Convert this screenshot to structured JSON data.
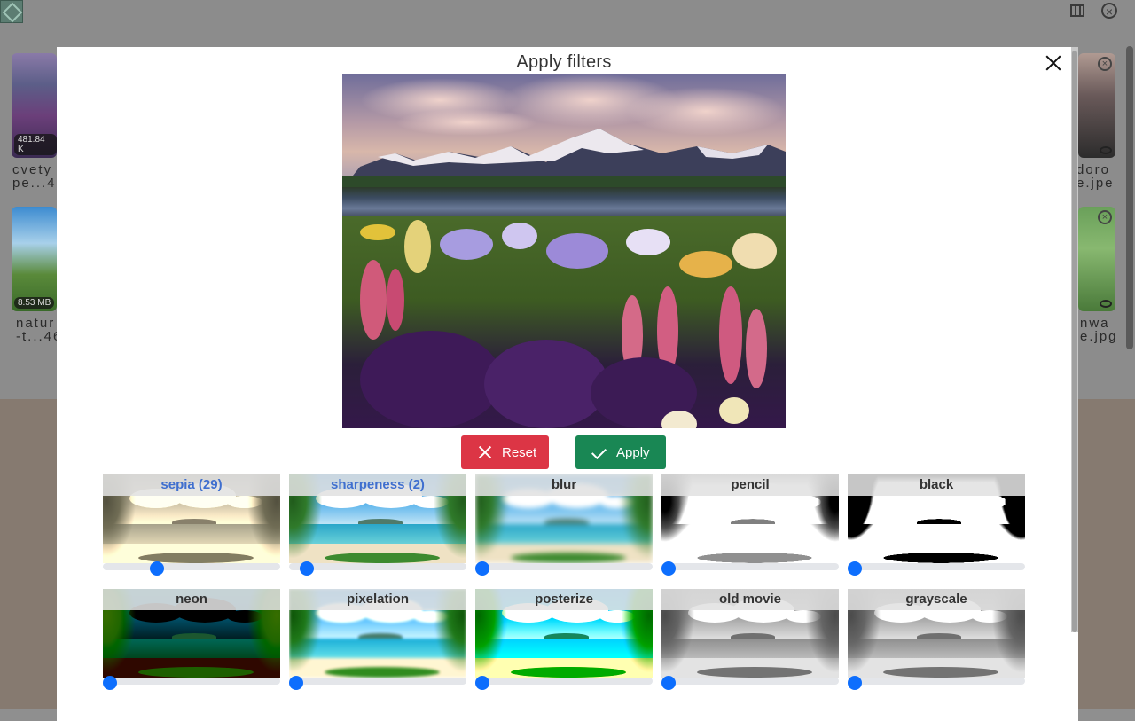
{
  "window": {
    "logo_icon": "image-icon",
    "columns_icon": "columns-icon",
    "close_icon": "circle-close-icon"
  },
  "gallery": {
    "cards": [
      {
        "size": "481.84 K",
        "name_line1": "cvety",
        "name_line2": "pe...4"
      },
      {
        "size": "8.53 MB",
        "name_line1": "natur",
        "name_line2": "-t...46"
      },
      {
        "size": "",
        "name_line1": "doro",
        "name_line2": "e.jpe"
      },
      {
        "size": "",
        "name_line1": "nwa",
        "name_line2": "e.jpg"
      }
    ]
  },
  "modal": {
    "title": "Apply filters",
    "close_icon": "close-icon",
    "buttons": {
      "reset": "Reset",
      "apply": "Apply"
    },
    "filters": [
      {
        "label": "sepia (29)",
        "active": true,
        "value": 29,
        "style": "sepia"
      },
      {
        "label": "sharpeness (2)",
        "active": true,
        "value": 2,
        "style": "normal"
      },
      {
        "label": "blur",
        "active": false,
        "value": 0,
        "style": "blur"
      },
      {
        "label": "pencil",
        "active": false,
        "value": 0,
        "style": "pencil"
      },
      {
        "label": "black",
        "active": false,
        "value": 0,
        "style": "black"
      },
      {
        "label": "neon",
        "active": false,
        "value": 0,
        "style": "neon"
      },
      {
        "label": "pixelation",
        "active": false,
        "value": 0,
        "style": "pixel"
      },
      {
        "label": "posterize",
        "active": false,
        "value": 0,
        "style": "poster"
      },
      {
        "label": "old movie",
        "active": false,
        "value": 0,
        "style": "gray"
      },
      {
        "label": "grayscale",
        "active": false,
        "value": 0,
        "style": "gray"
      }
    ]
  },
  "colors": {
    "reset": "#dc3545",
    "apply": "#198754",
    "slider_knob": "#0d6efd",
    "active_label": "#3f6fcf"
  }
}
